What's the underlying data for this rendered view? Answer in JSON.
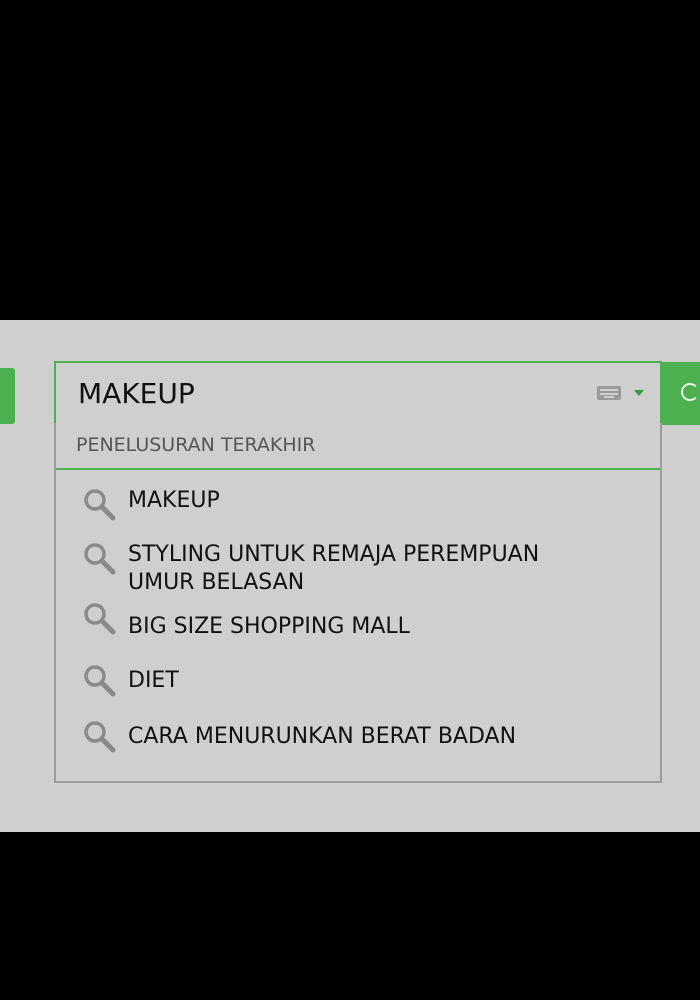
{
  "search": {
    "value": "MAKEUP",
    "placeholder": ""
  },
  "dropdown": {
    "header": "PENELUSURAN TERAKHIR",
    "items": [
      {
        "label": "MAKEUP"
      },
      {
        "label": "STYLING UNTUK REMAJA PEREMPUAN\nUMUR BELASAN"
      },
      {
        "label": "BIG SIZE SHOPPING MALL"
      },
      {
        "label": "DIET"
      },
      {
        "label": "CARA MENURUNKAN BERAT BADAN"
      }
    ]
  },
  "icons": {
    "input_tool": "keyboard-icon",
    "dropdown_toggle": "chevron-down-icon",
    "search": "search-icon",
    "history_item": "magnifier-icon"
  },
  "colors": {
    "accent": "#4caf50",
    "panel": "#cfcfcf",
    "backdrop": "#000000"
  }
}
